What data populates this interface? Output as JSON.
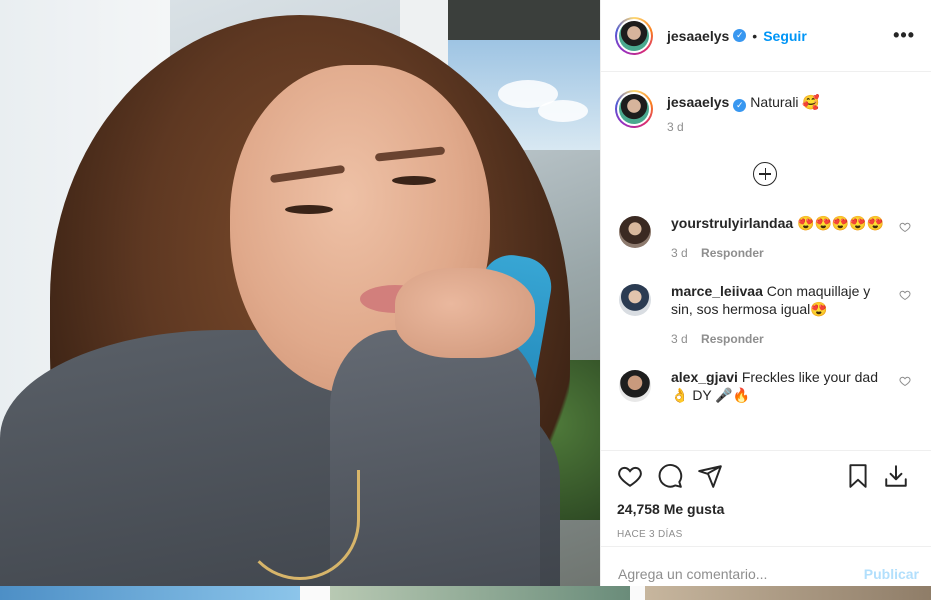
{
  "post": {
    "username": "jesaaelys",
    "follow_label": "Seguir",
    "separator": "•",
    "verified_glyph": "✓",
    "more_label": "•••"
  },
  "caption": {
    "username": "jesaaelys",
    "text": "Naturali 🥰",
    "time": "3 d"
  },
  "comments": [
    {
      "username": "yourstrulyirlandaa",
      "text": "😍😍😍😍😍",
      "time": "3 d",
      "reply_label": "Responder"
    },
    {
      "username": "marce_leiivaa",
      "text": "Con maquillaje y sin, sos hermosa igual😍",
      "time": "3 d",
      "reply_label": "Responder"
    },
    {
      "username": "alex_gjavi",
      "text": "Freckles like your dad 👌 DY 🎤🔥"
    }
  ],
  "actions": {
    "likes": "24,758 Me gusta",
    "posted_ago": "HACE 3 DÍAS"
  },
  "add_comment": {
    "placeholder": "Agrega un comentario...",
    "publish_label": "Publicar"
  },
  "colors": {
    "accent": "#0095f6",
    "publish_disabled": "#b2dffc",
    "muted": "#8e8e8e",
    "verified": "#3897f0"
  }
}
